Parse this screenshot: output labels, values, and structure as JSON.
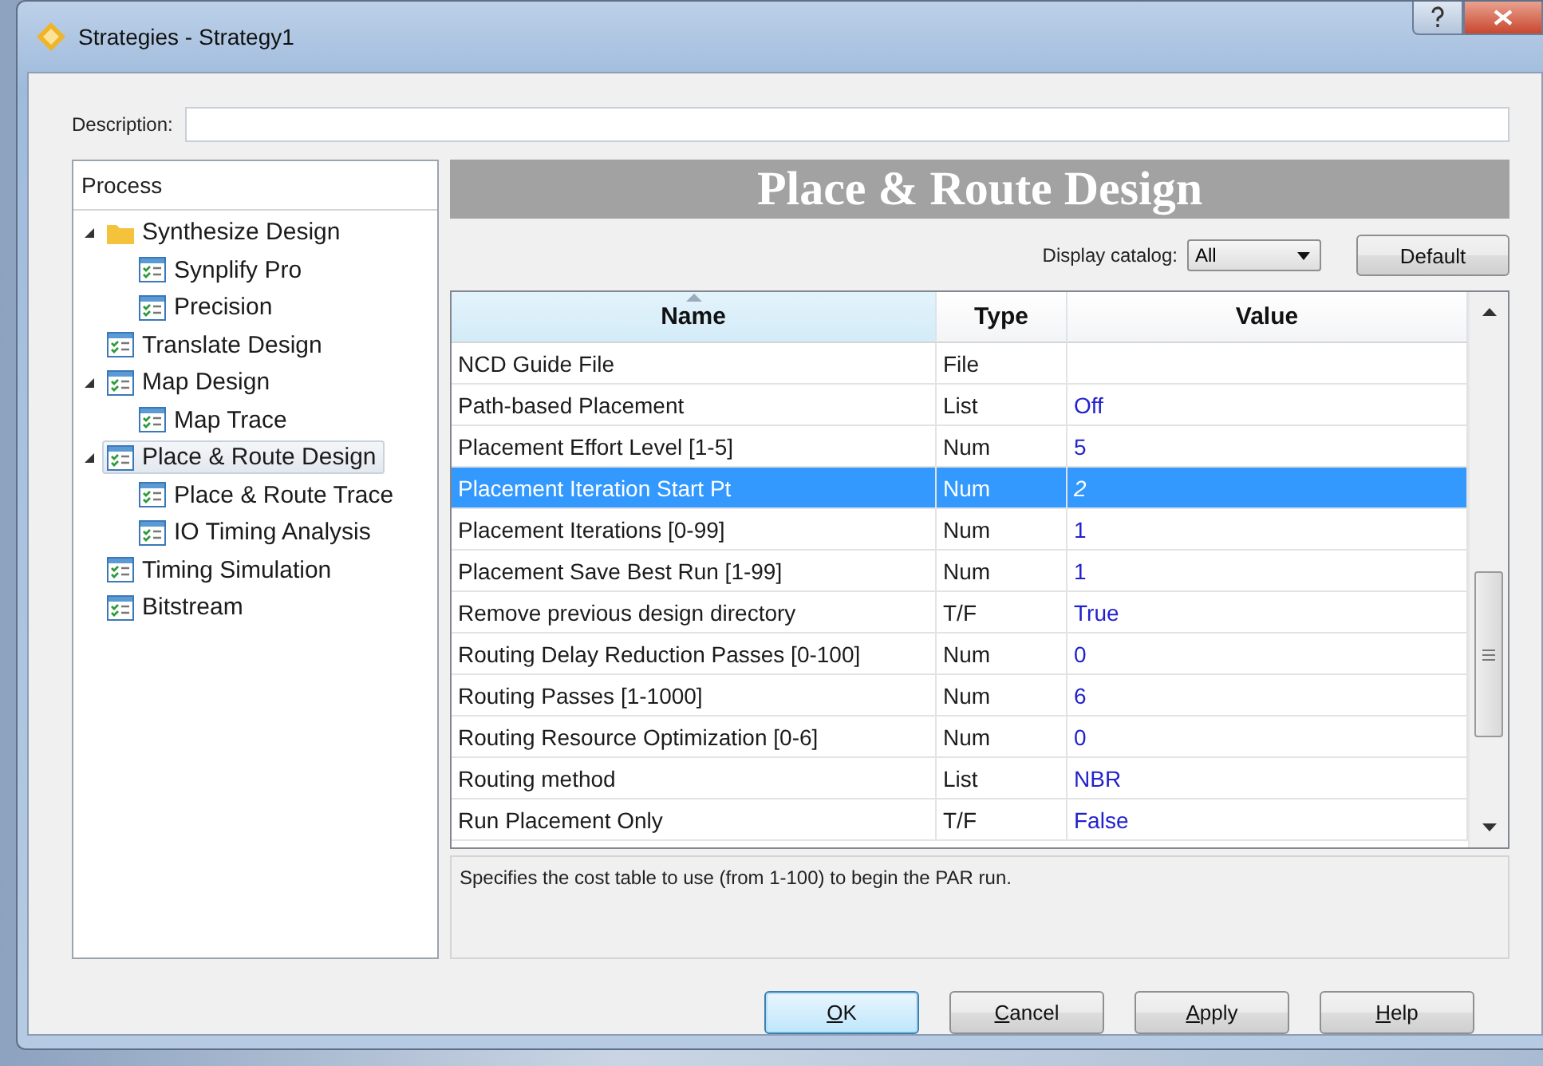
{
  "window": {
    "title": "Strategies - Strategy1"
  },
  "description": {
    "label": "Description:"
  },
  "process_tree": {
    "header": "Process",
    "items": [
      {
        "label": "Synthesize Design",
        "kind": "folder",
        "expanded": true,
        "selected": false,
        "children": [
          {
            "label": "Synplify Pro",
            "kind": "process",
            "selected": false
          },
          {
            "label": "Precision",
            "kind": "process",
            "selected": false
          }
        ]
      },
      {
        "label": "Translate Design",
        "kind": "process",
        "selected": false
      },
      {
        "label": "Map Design",
        "kind": "process",
        "expanded": true,
        "selected": false,
        "children": [
          {
            "label": "Map Trace",
            "kind": "process",
            "selected": false
          }
        ]
      },
      {
        "label": "Place & Route Design",
        "kind": "process",
        "expanded": true,
        "selected": true,
        "children": [
          {
            "label": "Place & Route Trace",
            "kind": "process",
            "selected": false
          },
          {
            "label": "IO Timing Analysis",
            "kind": "process",
            "selected": false
          }
        ]
      },
      {
        "label": "Timing Simulation",
        "kind": "process",
        "selected": false
      },
      {
        "label": "Bitstream",
        "kind": "process",
        "selected": false
      }
    ]
  },
  "panel": {
    "title": "Place & Route Design",
    "catalog_label": "Display catalog:",
    "catalog_value": "All",
    "default_button": "Default"
  },
  "table": {
    "columns": [
      "Name",
      "Type",
      "Value"
    ],
    "rows": [
      {
        "name": "NCD Guide File",
        "type": "File",
        "value": "",
        "selected": false
      },
      {
        "name": "Path-based Placement",
        "type": "List",
        "value": "Off",
        "selected": false
      },
      {
        "name": "Placement Effort Level [1-5]",
        "type": "Num",
        "value": "5",
        "selected": false
      },
      {
        "name": "Placement Iteration Start Pt",
        "type": "Num",
        "value": "2",
        "selected": true
      },
      {
        "name": "Placement Iterations [0-99]",
        "type": "Num",
        "value": "1",
        "selected": false
      },
      {
        "name": "Placement Save Best Run [1-99]",
        "type": "Num",
        "value": "1",
        "selected": false
      },
      {
        "name": "Remove previous design directory",
        "type": "T/F",
        "value": "True",
        "selected": false
      },
      {
        "name": "Routing Delay Reduction Passes [0-100]",
        "type": "Num",
        "value": "0",
        "selected": false
      },
      {
        "name": "Routing Passes [1-1000]",
        "type": "Num",
        "value": "6",
        "selected": false
      },
      {
        "name": "Routing Resource Optimization [0-6]",
        "type": "Num",
        "value": "0",
        "selected": false
      },
      {
        "name": "Routing method",
        "type": "List",
        "value": "NBR",
        "selected": false
      },
      {
        "name": "Run Placement Only",
        "type": "T/F",
        "value": "False",
        "selected": false
      }
    ]
  },
  "help_text": "Specifies the cost table to use (from 1-100) to begin the PAR run.",
  "buttons": [
    {
      "label": "OK",
      "default": true
    },
    {
      "label": "Cancel",
      "default": false
    },
    {
      "label": "Apply",
      "default": false
    },
    {
      "label": "Help",
      "default": false
    }
  ]
}
